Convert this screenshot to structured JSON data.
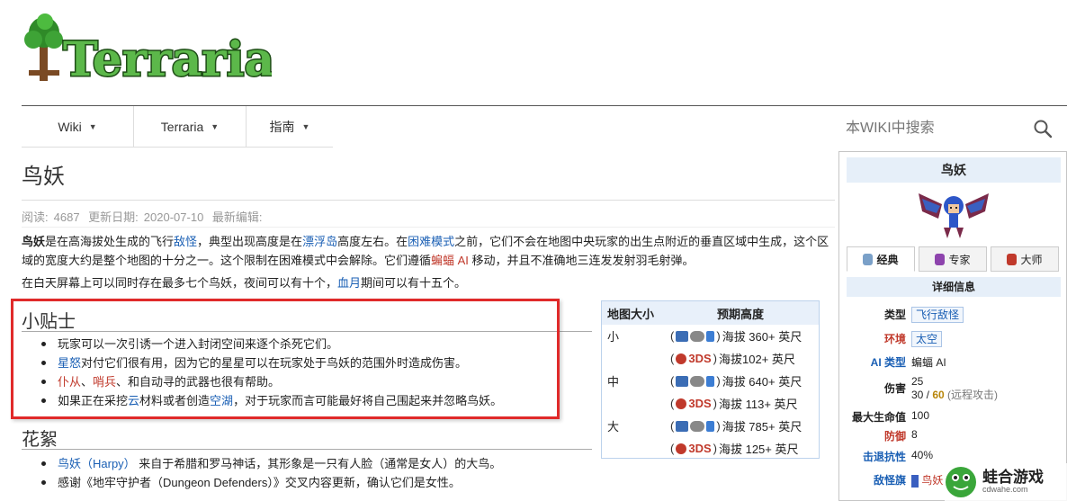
{
  "logo": {
    "text": "Terraria"
  },
  "nav": {
    "items": [
      {
        "label": "Wiki"
      },
      {
        "label": "Terraria"
      },
      {
        "label": "指南"
      }
    ]
  },
  "search": {
    "placeholder": "本WIKI中搜索"
  },
  "article": {
    "title": "鸟妖",
    "meta": {
      "views_label": "阅读:",
      "views": "4687",
      "updated_label": "更新日期:",
      "updated": "2020-07-10",
      "editor_label": "最新编辑:"
    },
    "intro": {
      "bold": "鸟妖",
      "t1": "是在高海拔处生成的飞行",
      "l1": "敌怪",
      "t2": "，典型出现高度是在",
      "l2": "漂浮岛",
      "t3": "高度左右。在",
      "l3": "困难模式",
      "t4": "之前，它们不会在地图中央玩家的出生点附近的垂直区域中生成，这个区域的宽度大约是整个地图的十分之一。这个限制在困难模式中会解除。它们遵循",
      "l4": "蝙蝠 AI",
      "t5": " 移动，并且不准确地三连发发射羽毛射弹。"
    },
    "para2": {
      "t1": "在白天屏幕上可以同时存在最多七个鸟妖，夜间可以有十个，",
      "l1": "血月",
      "t2": "期间可以有十五个。"
    },
    "tips": {
      "heading": "小贴士",
      "items": {
        "i1": "玩家可以一次引诱一个进入封闭空间来逐个杀死它们。",
        "i2_link": "星怒",
        "i2_rest": "对付它们很有用，因为它的星星可以在玩家处于鸟妖的范围外时造成伤害。",
        "i3_l1": "仆从",
        "i3_sep": "、",
        "i3_l2": "哨兵",
        "i3_rest": "、和自动寻的武器也很有帮助。",
        "i4_t1": "如果正在采挖",
        "i4_l1": "云",
        "i4_t2": "材料或者创造",
        "i4_l2": "空湖",
        "i4_t3": "，对于玩家而言可能最好将自己围起来并忽略鸟妖。"
      }
    },
    "trivia": {
      "heading": "花絮",
      "items": {
        "i1_link": "鸟妖（Harpy）",
        "i1_rest": " 来自于希腊和罗马神话，其形象是一只有人脸（通常是女人）的大鸟。",
        "i2": "感谢《地牢守护者（Dungeon Defenders）》交叉内容更新，确认它们是女性。"
      }
    }
  },
  "height_table": {
    "col_size": "地图大小",
    "col_height": "预期高度",
    "rows": [
      {
        "size": "小",
        "main": "海拔 360+ 英尺",
        "n3ds": "海拔102+ 英尺"
      },
      {
        "size": "中",
        "main": "海拔 640+ 英尺",
        "n3ds": "海拔 113+ 英尺"
      },
      {
        "size": "大",
        "main": "海拔 785+ 英尺",
        "n3ds": "海拔 125+ 英尺"
      }
    ],
    "platform_3ds": "3DS",
    "open_paren": "(",
    "close_paren": ")"
  },
  "infobox": {
    "title": "鸟妖",
    "tabs": [
      {
        "label": "经典",
        "color": "#7aa0c8"
      },
      {
        "label": "专家",
        "color": "#8e44ad"
      },
      {
        "label": "大师",
        "color": "#c0392b"
      }
    ],
    "details_title": "详细信息",
    "rows": {
      "type_k": "类型",
      "type_v": "飞行敌怪",
      "env_k": "环境",
      "env_v": "太空",
      "ai_k": "AI 类型",
      "ai_v": "蝙蝠 AI",
      "dmg_k": "伤害",
      "dmg_v1": "25",
      "dmg_v2a": "30 / ",
      "dmg_v2b": "60",
      "dmg_v2c": " (远程攻击)",
      "hp_k": "最大生命值",
      "hp_v": "100",
      "def_k": "防御",
      "def_v": "8",
      "kb_k": "击退抗性",
      "kb_v": "40%",
      "banner_k": "敌怪旗",
      "banner_v": "鸟妖"
    }
  },
  "watermark": {
    "name": "蛙合游戏",
    "url": "cdwahe.com"
  },
  "colors": {
    "accent_red": "#e02a2a",
    "link_blue": "#1a5fb4",
    "link_red": "#c0392b",
    "logo_green": "#4fa83a"
  }
}
